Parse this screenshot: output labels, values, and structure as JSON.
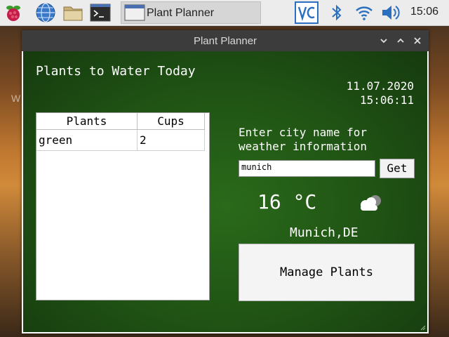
{
  "taskbar": {
    "task_label": "Plant Planner",
    "clock": "15:06",
    "icons": [
      "raspberry-menu-icon",
      "globe-icon",
      "folder-icon",
      "terminal-icon",
      "vnc-icon",
      "bluetooth-icon",
      "wifi-icon",
      "volume-icon"
    ]
  },
  "background": {
    "hint": "W"
  },
  "window": {
    "title": "Plant Planner",
    "heading": "Plants to Water Today",
    "date": "11.07.2020",
    "time": "15:06:11",
    "table": {
      "columns": [
        "Plants",
        "Cups"
      ],
      "rows": [
        {
          "plant": "green",
          "cups": "2"
        }
      ]
    },
    "weather": {
      "prompt_line1": "Enter city name for",
      "prompt_line2": "weather information",
      "city_value": "munich",
      "get_label": "Get",
      "temperature": "16 °C",
      "condition_icon": "cloud-icon",
      "city_result": "Munich,DE"
    },
    "manage_label": "Manage Plants"
  },
  "colors": {
    "content_bg": "#1f5214",
    "titlebar": "#3c3c3c",
    "taskbar": "#ececec"
  }
}
